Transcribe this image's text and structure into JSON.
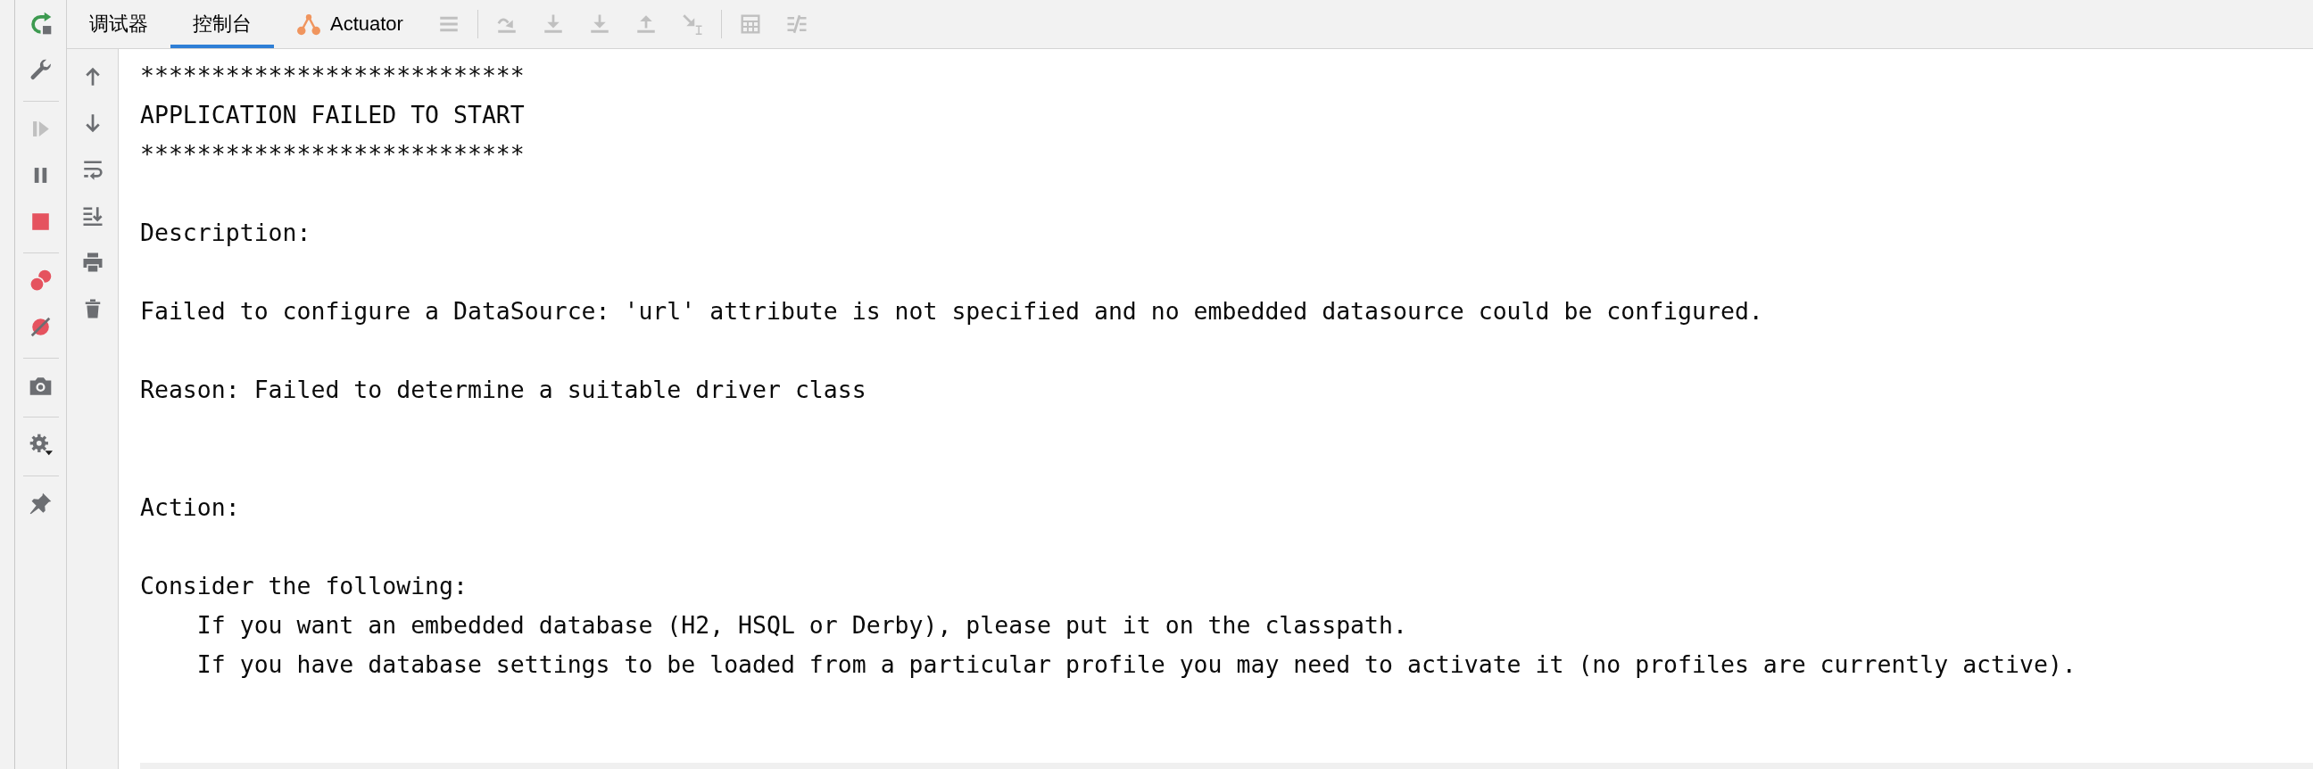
{
  "debug_sidebar": {
    "groups": [
      [
        {
          "kind": "rerun",
          "disabled": false
        },
        {
          "kind": "settings",
          "disabled": false
        }
      ],
      [
        {
          "kind": "resume",
          "disabled": true
        },
        {
          "kind": "pause",
          "disabled": false
        },
        {
          "kind": "stop",
          "disabled": false
        }
      ],
      [
        {
          "kind": "breakpoints",
          "disabled": false
        },
        {
          "kind": "mute",
          "disabled": false
        }
      ],
      [
        {
          "kind": "snapshot",
          "disabled": false
        }
      ],
      [
        {
          "kind": "options",
          "disabled": false
        }
      ],
      [
        {
          "kind": "pin",
          "disabled": false
        }
      ]
    ]
  },
  "tabs": [
    {
      "label": "调试器",
      "selected": false,
      "kind": "plain"
    },
    {
      "label": "控制台",
      "selected": true,
      "kind": "plain"
    },
    {
      "label": "Actuator",
      "selected": false,
      "kind": "iconic"
    }
  ],
  "toolbar": {
    "groups": [
      [
        {
          "kind": "layout",
          "disabled": true
        }
      ],
      [
        {
          "kind": "stepover",
          "disabled": true
        },
        {
          "kind": "stepinto",
          "disabled": true
        },
        {
          "kind": "forcestepinto",
          "disabled": true
        },
        {
          "kind": "stepout",
          "disabled": true
        },
        {
          "kind": "runtocursor",
          "disabled": true
        }
      ],
      [
        {
          "kind": "evaluate",
          "disabled": true
        },
        {
          "kind": "trace",
          "disabled": true
        }
      ]
    ]
  },
  "console_toolbar": {
    "items": [
      {
        "kind": "up"
      },
      {
        "kind": "down"
      },
      {
        "kind": "wrap"
      },
      {
        "kind": "scrollend"
      },
      {
        "kind": "print"
      },
      {
        "kind": "clear"
      }
    ]
  },
  "console": {
    "output": "***************************\nAPPLICATION FAILED TO START\n***************************\n\nDescription:\n\nFailed to configure a DataSource: 'url' attribute is not specified and no embedded datasource could be configured.\n\nReason: Failed to determine a suitable driver class\n\n\nAction:\n\nConsider the following:\n    If you want an embedded database (H2, HSQL or Derby), please put it on the classpath.\n    If you have database settings to be loaded from a particular profile you may need to activate it (no profiles are currently active)."
  }
}
